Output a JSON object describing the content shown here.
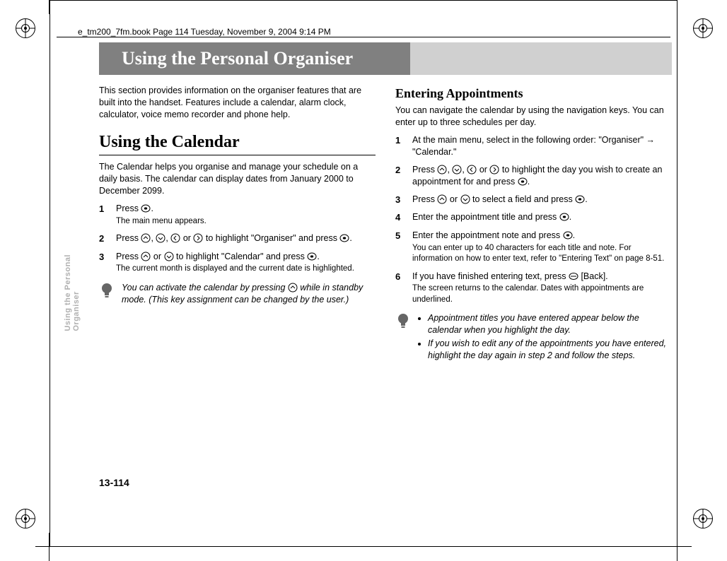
{
  "header_path": "e_tm200_7fm.book  Page 114  Tuesday, November 9, 2004  9:14 PM",
  "chapter_title": "Using the Personal Organiser",
  "side_tab": "Using the Personal\nOrganiser",
  "page_number": "13-114",
  "left": {
    "intro": "This section provides information on the organiser features that are built into the handset. Features include a calendar, alarm clock, calculator, voice memo recorder and phone help.",
    "h1": "Using the Calendar",
    "para": "The Calendar helps you organise and manage your schedule on a daily basis. The calendar can display dates from January 2000 to December 2099.",
    "steps": {
      "1a": "Press ",
      "1b": ".",
      "1sub": "The main menu appears.",
      "2a": "Press ",
      "2b": ", ",
      "2c": ", ",
      "2d": " or ",
      "2e": " to highlight \"Organiser\" and press ",
      "2f": ".",
      "3a": "Press ",
      "3b": " or ",
      "3c": " to highlight \"Calendar\" and press ",
      "3d": ".",
      "3sub": "The current month is displayed and the current date is highlighted."
    },
    "tip_a": "You can activate the calendar by pressing ",
    "tip_b": " while in standby mode. (This key assignment can be changed by the user.)"
  },
  "right": {
    "h2": "Entering Appointments",
    "para": "You can navigate the calendar by using the navigation keys. You can enter up to three schedules per day.",
    "steps": {
      "1a": "At the main menu, select in the following order: \"Organiser\" → \"Calendar.\"",
      "2a": "Press ",
      "2b": ", ",
      "2c": ", ",
      "2d": " or ",
      "2e": " to highlight the day you wish to create an appointment for and press ",
      "2f": ".",
      "3a": "Press ",
      "3b": " or ",
      "3c": " to select a field and press ",
      "3d": ".",
      "4a": "Enter the appointment title and press ",
      "4b": ".",
      "5a": "Enter the appointment note and press ",
      "5b": ".",
      "5sub": "You can enter up to 40 characters for each title and note. For information on how to enter text, refer to \"Entering Text\" on page 8-51.",
      "6a": "If you have finished entering text, press ",
      "6b": " [Back].",
      "6sub": "The screen returns to the calendar. Dates with appointments are underlined."
    },
    "tips": {
      "1": "Appointment titles you have entered appear below the calendar when you highlight the day.",
      "2": "If you wish to edit any of the appointments you have entered, highlight the day again in step 2 and follow the steps."
    }
  }
}
